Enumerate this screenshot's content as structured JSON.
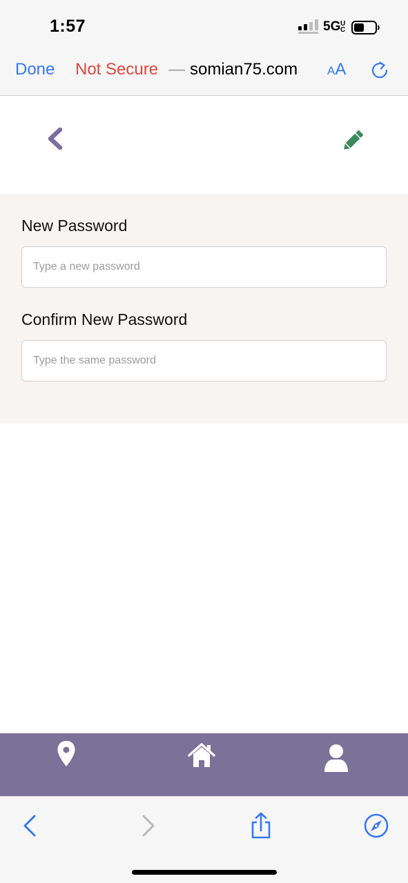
{
  "status_bar": {
    "time": "1:57",
    "network": "5G",
    "network_sup": "U\nC"
  },
  "browser": {
    "done_label": "Done",
    "not_secure_label": "Not Secure",
    "separator": "—",
    "url": "somian75.com",
    "text_size_small": "A",
    "text_size_large": "A"
  },
  "form": {
    "new_password": {
      "label": "New Password",
      "placeholder": "Type a new password",
      "value": ""
    },
    "confirm_password": {
      "label": "Confirm New Password",
      "placeholder": "Type the same password",
      "value": ""
    }
  },
  "icons": {
    "back": "chevron-left-icon",
    "edit": "pencil-icon",
    "location": "map-pin-icon",
    "home": "home-icon",
    "profile": "user-icon",
    "browser_back": "chevron-left-icon",
    "browser_forward": "chevron-right-icon",
    "share": "share-icon",
    "bookmarks": "compass-icon"
  },
  "colors": {
    "ios_blue": "#3478f6",
    "not_secure_red": "#e0483e",
    "brand_purple": "#7b7299",
    "edit_green": "#3c8a5b",
    "form_background": "#f8f4f1"
  }
}
